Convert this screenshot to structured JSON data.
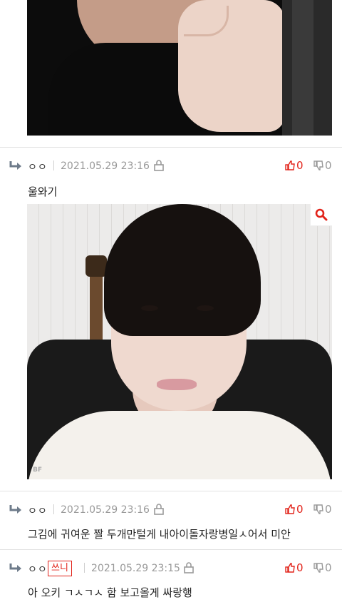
{
  "comments": [
    {
      "nick": "ㅇㅇ",
      "date": "2021.05.29 23:16",
      "up": "0",
      "down": "0",
      "text": "울와기"
    },
    {
      "nick": "ㅇㅇ",
      "date": "2021.05.29 23:16",
      "up": "0",
      "down": "0",
      "text": "그김에 귀여운 짤 두개만털게 내아이돌자랑병일ㅅ어서 미안"
    },
    {
      "nick": "ㅇㅇ",
      "badge": "쓰니",
      "date": "2021.05.29 23:15",
      "up": "0",
      "down": "0",
      "text": "아 오키 ㄱㅅㄱㅅ 함 보고올게 싸랑행"
    }
  ],
  "photo": {
    "watermark": "BF"
  },
  "icons": {
    "reply": "reply-arrow-icon",
    "lock": "lock-icon",
    "up": "thumbs-up-icon",
    "down": "thumbs-down-icon",
    "zoom": "magnifier-icon"
  },
  "colors": {
    "accent": "#e2231a",
    "muted": "#999999"
  }
}
